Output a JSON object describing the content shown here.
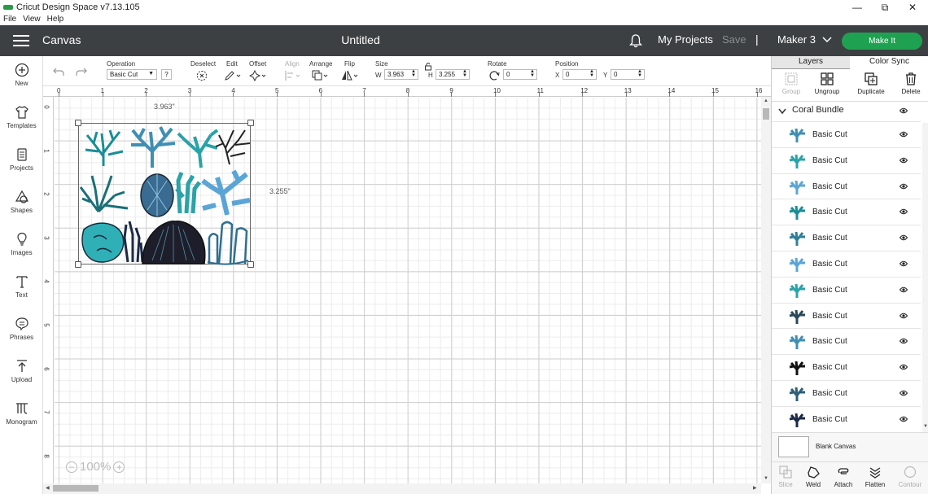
{
  "window": {
    "app_title": "Cricut Design Space  v7.13.105",
    "min": "—",
    "max": "⧉",
    "close": "✕"
  },
  "menu": [
    "File",
    "View",
    "Help"
  ],
  "header": {
    "section": "Canvas",
    "doc_title": "Untitled",
    "my_projects": "My Projects",
    "save": "Save",
    "separator": "|",
    "machine": "Maker 3",
    "make_it": "Make It"
  },
  "left_toolbar": [
    {
      "label": "New",
      "icon": "plus-circle-icon"
    },
    {
      "label": "Templates",
      "icon": "shirt-icon"
    },
    {
      "label": "Projects",
      "icon": "projects-icon"
    },
    {
      "label": "Shapes",
      "icon": "shapes-icon"
    },
    {
      "label": "Images",
      "icon": "bulb-icon"
    },
    {
      "label": "Text",
      "icon": "text-icon"
    },
    {
      "label": "Phrases",
      "icon": "chat-icon"
    },
    {
      "label": "Upload",
      "icon": "upload-icon"
    },
    {
      "label": "Monogram",
      "icon": "monogram-icon"
    }
  ],
  "edit_toolbar": {
    "operation_label": "Operation",
    "operation_value": "Basic Cut",
    "help": "?",
    "deselect": "Deselect",
    "edit": "Edit",
    "offset": "Offset",
    "align": "Align",
    "arrange": "Arrange",
    "flip": "Flip",
    "size_label": "Size",
    "w_label": "W",
    "w_value": "3.963",
    "h_label": "H",
    "h_value": "3.255",
    "rotate_label": "Rotate",
    "rotate_value": "0",
    "position_label": "Position",
    "x_label": "X",
    "x_value": "0",
    "y_label": "Y",
    "y_value": "0"
  },
  "canvas": {
    "ruler_top": [
      "0",
      "1",
      "2",
      "3",
      "4",
      "5",
      "6",
      "7",
      "8",
      "9",
      "10",
      "11",
      "12",
      "13",
      "14",
      "15",
      "16"
    ],
    "ruler_left": [
      "0",
      "1",
      "2",
      "3",
      "4",
      "5",
      "6",
      "7",
      "8"
    ],
    "width_label": "3.963\"",
    "height_label": "3.255\"",
    "zoom": "100%",
    "zoom_minus": "−",
    "zoom_plus": "+"
  },
  "right_panel": {
    "tabs": [
      "Layers",
      "Color Sync"
    ],
    "actions": [
      "Group",
      "Ungroup",
      "Duplicate",
      "Delete"
    ],
    "group_name": "Coral Bundle",
    "layers": [
      "Basic Cut",
      "Basic Cut",
      "Basic Cut",
      "Basic Cut",
      "Basic Cut",
      "Basic Cut",
      "Basic Cut",
      "Basic Cut",
      "Basic Cut",
      "Basic Cut",
      "Basic Cut",
      "Basic Cut"
    ],
    "blank_canvas": "Blank Canvas",
    "bottom_actions": [
      "Slice",
      "Weld",
      "Attach",
      "Flatten",
      "Contour"
    ]
  },
  "colors": {
    "header_bg": "#3d4043",
    "make_it": "#1fa152",
    "teal": "#2fb0b7",
    "blue": "#5aa5d6",
    "dark": "#1e1e2a"
  }
}
